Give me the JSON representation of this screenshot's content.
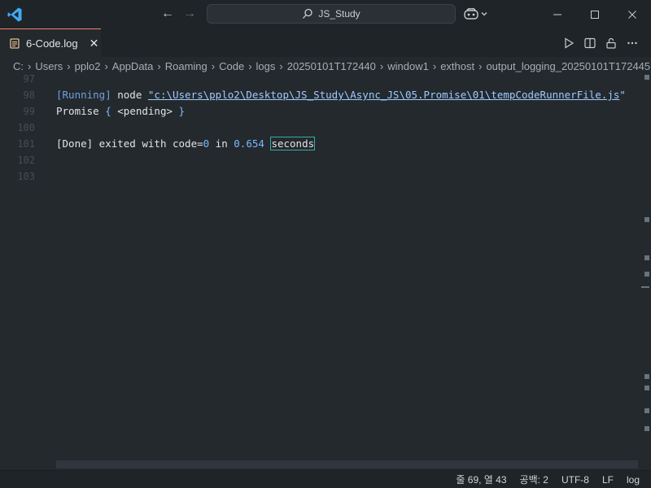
{
  "titlebar": {
    "search_text": "JS_Study",
    "colors": {
      "vscode_blue": "#3fa9f5"
    }
  },
  "tab": {
    "label": "6-Code.log"
  },
  "breadcrumb": [
    "C:",
    "Users",
    "pplo2",
    "AppData",
    "Roaming",
    "Code",
    "logs",
    "20250101T172440",
    "window1",
    "exthost",
    "output_logging_20250101T172445"
  ],
  "editor": {
    "line_numbers": [
      "97",
      "98",
      "99",
      "100",
      "101",
      "102",
      "103"
    ],
    "lines": {
      "l98": {
        "running": "[Running]",
        "cmd": " node ",
        "quote_open": "\"",
        "path": "c:\\Users\\pplo2\\Desktop\\JS_Study\\Async_JS\\05.Promise\\01\\tempCodeRunnerFile.js",
        "quote_close": "\""
      },
      "l99": {
        "promise": "Promise ",
        "brace_open": "{",
        "pending": " <pending> ",
        "brace_close": "}"
      },
      "l101": {
        "done": "[Done]",
        "text1": " exited with code=",
        "code": "0",
        "text2": " in ",
        "secs": "0.654",
        "space": " ",
        "seconds": "seconds"
      }
    }
  },
  "statusbar": {
    "position": "줄 69, 열 43",
    "indent": "공백: 2",
    "encoding": "UTF-8",
    "eol": "LF",
    "language": "log"
  }
}
